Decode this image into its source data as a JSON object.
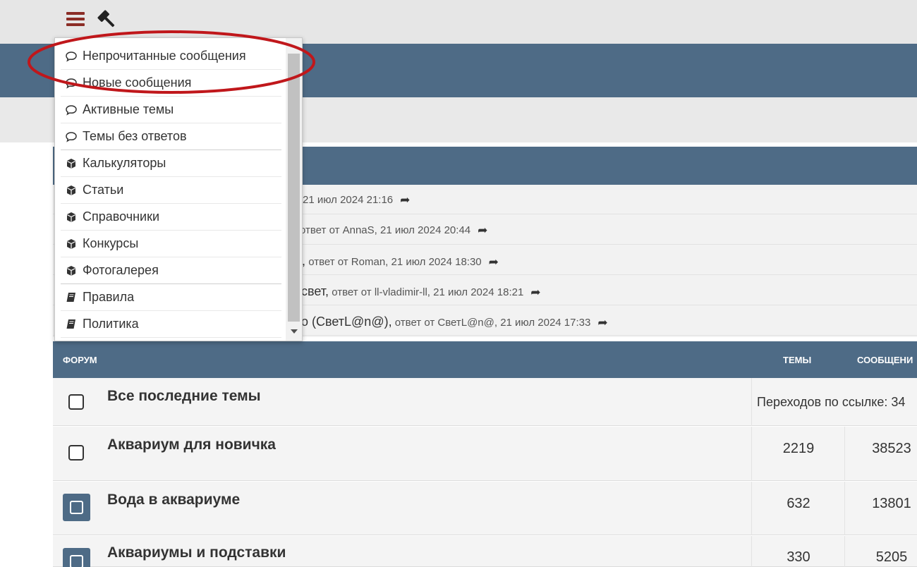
{
  "topbar": {
    "menu_icon": "hamburger-menu-icon",
    "tool_icon": "gavel-icon"
  },
  "dropdown": {
    "items": [
      {
        "icon": "speech-bubble-icon",
        "label": "Непрочитанные сообщения"
      },
      {
        "icon": "speech-bubble-icon",
        "label": "Новые сообщения"
      },
      {
        "icon": "speech-bubble-icon",
        "label": "Активные темы"
      },
      {
        "icon": "speech-bubble-icon",
        "label": "Темы без ответов"
      },
      {
        "icon": "cube-icon",
        "label": "Калькуляторы"
      },
      {
        "icon": "cube-icon",
        "label": "Статьи"
      },
      {
        "icon": "cube-icon",
        "label": "Справочники"
      },
      {
        "icon": "cube-icon",
        "label": "Конкурсы"
      },
      {
        "icon": "cube-icon",
        "label": "Фотогалерея"
      },
      {
        "icon": "book-icon",
        "label": "Правила"
      },
      {
        "icon": "book-icon",
        "label": "Политика"
      }
    ]
  },
  "recent_posts": [
    {
      "text": "21 июл 2024 21:16"
    },
    {
      "text": "ответ от AnnaS, 21 июл 2024 20:44"
    },
    {
      "lead": ",",
      "text": "ответ от Roman, 21 июл 2024 18:30"
    },
    {
      "lead": "свет,",
      "text": "ответ от ll-vladimir-ll, 21 июл 2024 18:21"
    },
    {
      "lead": "о (СветL@n@),",
      "text": "ответ от СветL@n@, 21 июл 2024 17:33"
    }
  ],
  "forum_table": {
    "headers": {
      "forum": "ФОРУМ",
      "topics": "ТЕМЫ",
      "posts": "СООБЩЕНИ"
    },
    "rows": [
      {
        "title": "Все последние темы",
        "extra": "Переходов по ссылке: 34",
        "unread": false
      },
      {
        "title": "Аквариум для новичка",
        "topics": "2219",
        "posts": "38523",
        "unread": false
      },
      {
        "title": "Вода в аквариуме",
        "topics": "632",
        "posts": "13801",
        "unread": true
      },
      {
        "title": "Аквариумы и подставки",
        "topics": "330",
        "posts": "5205",
        "unread": true
      }
    ]
  },
  "colors": {
    "header_blue": "#4e6b86",
    "accent_red": "#c0171b",
    "menu_icon_red": "#8b2d26"
  }
}
